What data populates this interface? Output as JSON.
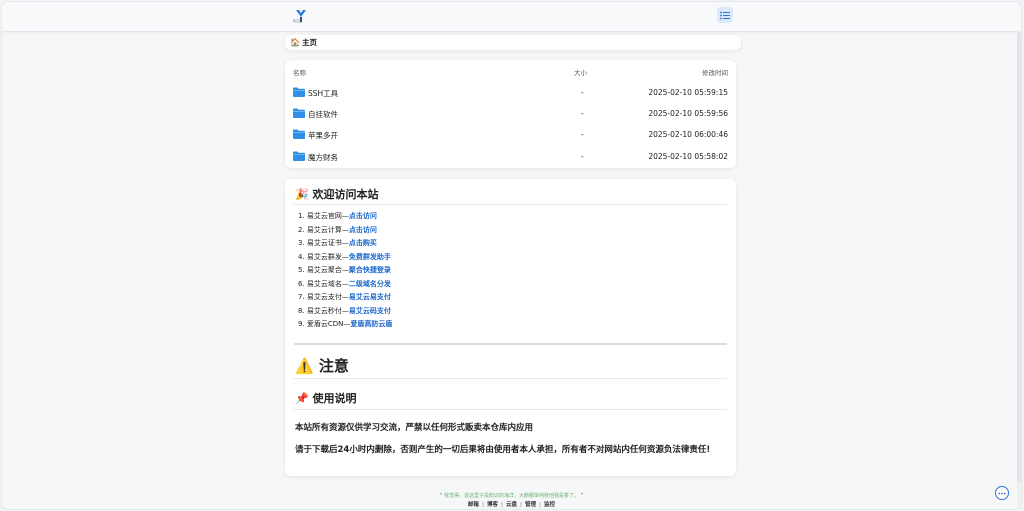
{
  "header": {
    "logo_text": "有艾云"
  },
  "breadcrumb": {
    "home_label": "主页"
  },
  "files": {
    "columns": {
      "name": "名称",
      "size": "大小",
      "modified": "修改时间"
    },
    "rows": [
      {
        "name": "SSH工具",
        "size": "-",
        "modified": "2025-02-10 05:59:15"
      },
      {
        "name": "自挂软件",
        "size": "-",
        "modified": "2025-02-10 05:59:56"
      },
      {
        "name": "苹果多开",
        "size": "-",
        "modified": "2025-02-10 06:00:46"
      },
      {
        "name": "魔方财务",
        "size": "-",
        "modified": "2025-02-10 05:58:02"
      }
    ]
  },
  "welcome": {
    "title": "🎉 欢迎访问本站",
    "links": [
      {
        "text": "1. 易艾云官网—",
        "link": "点击访问"
      },
      {
        "text": "2. 易艾云计算—",
        "link": "点击访问"
      },
      {
        "text": "3. 易艾云证书—",
        "link": "点击购买"
      },
      {
        "text": "4. 易艾云群发—",
        "link": "免费群发助手"
      },
      {
        "text": "5. 易艾云聚合—",
        "link": "聚合快捷登录"
      },
      {
        "text": "6. 易艾云域名—",
        "link": "二级域名分发"
      },
      {
        "text": "7. 易艾云支付—",
        "link": "易艾云易支付"
      },
      {
        "text": "8. 易艾云秒付—",
        "link": "易艾云码支付"
      },
      {
        "text": "9. 爱盾云CDN—",
        "link": "爱盾高防云盾"
      }
    ],
    "notice_title": "⚠️ 注意",
    "usage_title": "📌 使用说明",
    "para1": "本站所有资源仅供学习交流，严禁以任何形式贩卖本仓库内应用",
    "para2": "请于下载后24小时内删除，否则产生的一切后果将由使用者本人承担，所有者不对网站内任何资源负法律责任!"
  },
  "footer": {
    "quote_prefix": "“",
    "quote": "我觉得，说这里子是知识的海洋，大鹏都单纯我他我是香了。",
    "quote_suffix": "”",
    "links": [
      "邮箱",
      "博客",
      "云盘",
      "管理",
      "监控"
    ]
  },
  "colors": {
    "accent": "#1a66cc",
    "folder": "#2f8fe8",
    "quote": "#6ab56f"
  }
}
